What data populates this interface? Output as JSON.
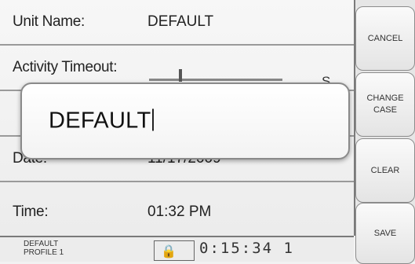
{
  "settings": {
    "unit_name_label": "Unit Name:",
    "unit_name_value": "DEFAULT",
    "timeout_label": "Activity Timeout:",
    "timeout_unit": "S",
    "date_label": "Date:",
    "date_value": "11/17/2009",
    "time_label": "Time:",
    "time_value": "01:32 PM"
  },
  "popup": {
    "text": "DEFAULT"
  },
  "softkeys": {
    "cancel": "CANCEL",
    "change_case": "CHANGE CASE",
    "clear": "CLEAR",
    "save": "SAVE"
  },
  "status": {
    "profile_label": "DEFAULT PROFILE 1",
    "counter": "0:15:34 1"
  },
  "icons": {
    "status_icon": "lock-icon"
  }
}
